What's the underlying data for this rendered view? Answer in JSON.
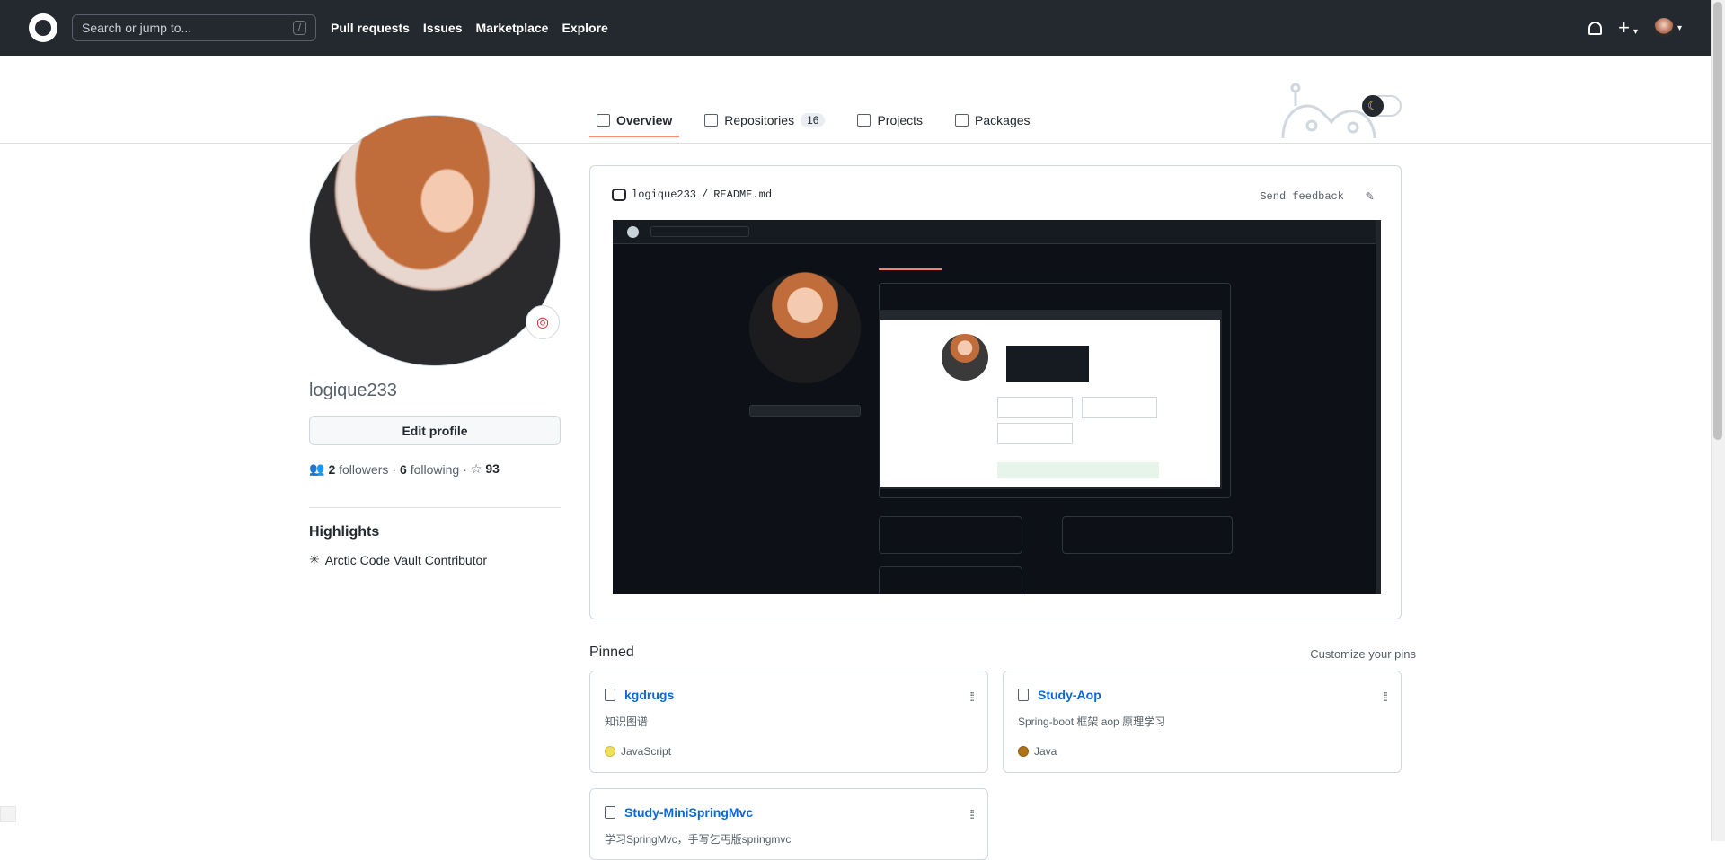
{
  "header": {
    "search_placeholder": "Search or jump to...",
    "search_shortcut": "/",
    "nav": [
      "Pull requests",
      "Issues",
      "Marketplace",
      "Explore"
    ]
  },
  "tabs": [
    {
      "label": "Overview",
      "icon": "book-icon"
    },
    {
      "label": "Repositories",
      "icon": "repo-icon",
      "count": "16"
    },
    {
      "label": "Projects",
      "icon": "project-icon"
    },
    {
      "label": "Packages",
      "icon": "package-icon"
    }
  ],
  "profile": {
    "username": "logique233",
    "edit_label": "Edit profile",
    "followers_count": "2",
    "followers_label": "followers",
    "following_count": "6",
    "following_label": "following",
    "stars_count": "93",
    "separator": "·"
  },
  "highlights": {
    "title": "Highlights",
    "item": "Arctic Code Vault Contributor"
  },
  "readme": {
    "path_user": "logique233",
    "path_sep": "/",
    "path_file": "README.md",
    "feedback": "Send feedback"
  },
  "pinned": {
    "title": "Pinned",
    "customize": "Customize your pins",
    "cards": [
      {
        "name": "kgdrugs",
        "desc": "知识图谱",
        "lang": "JavaScript",
        "color": "#f1e05a"
      },
      {
        "name": "Study-Aop",
        "desc": "Spring-boot 框架 aop 原理学习",
        "lang": "Java",
        "color": "#b07219"
      },
      {
        "name": "Study-MiniSpringMvc",
        "desc": "学习SpringMvc，手写乞丐版springmvc",
        "lang": "",
        "color": ""
      }
    ]
  },
  "colors": {
    "header_bg": "#24292f",
    "active_tab_underline": "#fd8c73",
    "link_blue": "#0969da"
  }
}
